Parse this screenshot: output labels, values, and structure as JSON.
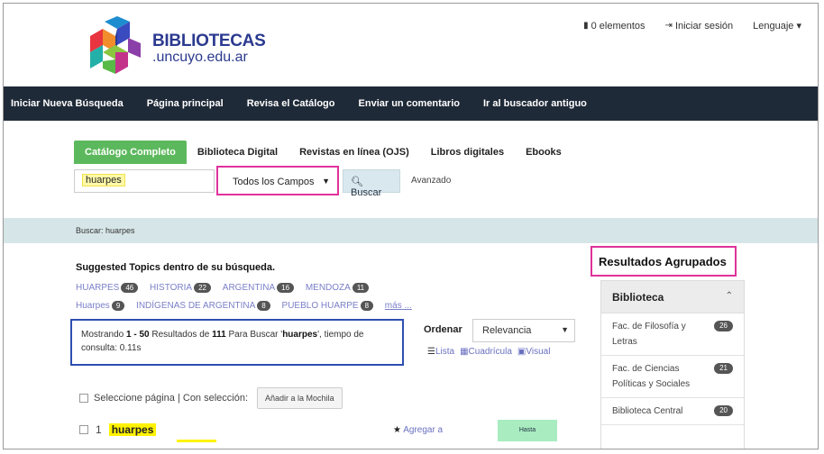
{
  "brand": {
    "title": "BIBLIOTECAS",
    "subtitle": ".uncuyo.edu.ar"
  },
  "topbar": {
    "cart": "0 elementos",
    "login": "Iniciar sesión",
    "language": "Lenguaje ▾"
  },
  "nav": [
    "Iniciar Nueva Búsqueda",
    "Página principal",
    "Revisa el Catálogo",
    "Enviar un comentario",
    "Ir al buscador antiguo"
  ],
  "tabs": [
    "Catálogo Completo",
    "Biblioteca Digital",
    "Revistas en línea (OJS)",
    "Libros digitales",
    "Ebooks"
  ],
  "search": {
    "query": "huarpes",
    "field": "Todos los Campos",
    "button": "Buscar",
    "advanced": "Avanzado"
  },
  "strip": {
    "text": "Buscar: huarpes"
  },
  "suggested": {
    "title": "Suggested Topics dentro de su búsqueda.",
    "topics": [
      {
        "label": "HUARPES",
        "count": "46"
      },
      {
        "label": "HISTORIA",
        "count": "22"
      },
      {
        "label": "ARGENTINA",
        "count": "16"
      },
      {
        "label": "MENDOZA",
        "count": "11"
      },
      {
        "label": "Huarpes",
        "count": "9"
      },
      {
        "label": "INDÍGENAS DE ARGENTINA",
        "count": "8"
      },
      {
        "label": "PUEBLO HUARPE",
        "count": "8"
      }
    ],
    "more": "más ..."
  },
  "results": {
    "prefix": "Mostrando ",
    "range": "1 - 50",
    "mid": " Resultados de ",
    "total": "111",
    "for": " Para Buscar '",
    "query": "huarpes",
    "tail": "', tiempo de consulta: 0.11s"
  },
  "sort": {
    "label": "Ordenar",
    "value": "Relevancia"
  },
  "views": {
    "list": "Lista",
    "grid": "Cuadrícula",
    "visual": "Visual"
  },
  "selection": {
    "text": "Seleccione página | Con selección:",
    "button": "Añadir a la Mochila"
  },
  "first_result": {
    "num": "1",
    "title": "huarpes",
    "add": "Agregar a",
    "status": "Hasta"
  },
  "facets": {
    "heading": "Resultados Agrupados",
    "group": "Biblioteca",
    "items": [
      {
        "name": "Fac. de Filosofía y Letras",
        "count": "26"
      },
      {
        "name": "Fac. de Ciencias Políticas y Sociales",
        "count": "21"
      },
      {
        "name": "Biblioteca Central",
        "count": "20"
      }
    ]
  },
  "colors": {
    "nav_bg": "#1f2a38",
    "tab_active": "#5cb85c",
    "highlight_pink": "#e0329a",
    "highlight_blue": "#2d4fb0",
    "strip_bg": "#d6e6e8"
  }
}
